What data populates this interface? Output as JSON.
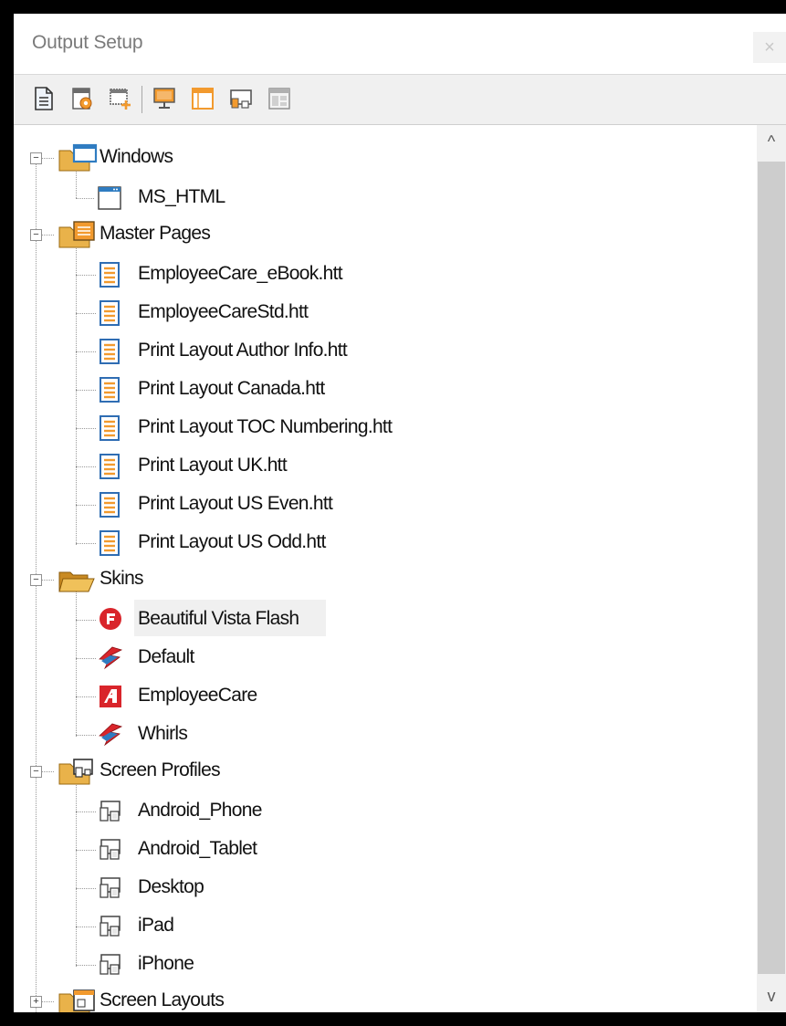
{
  "window": {
    "title": "Output Setup",
    "close_label": "×"
  },
  "toolbar": {
    "buttons": [
      {
        "icon": "new-document-icon"
      },
      {
        "icon": "properties-icon"
      },
      {
        "icon": "add-window-icon"
      },
      {
        "icon": "monitor-icon"
      },
      {
        "icon": "window-frame-icon"
      },
      {
        "icon": "screen-profile-icon"
      },
      {
        "icon": "layout-grid-icon"
      }
    ]
  },
  "tree": {
    "windows": {
      "label": "Windows",
      "children": [
        "MS_HTML"
      ]
    },
    "master_pages": {
      "label": "Master Pages",
      "children": [
        "EmployeeCare_eBook.htt",
        "EmployeeCareStd.htt",
        "Print Layout Author Info.htt",
        "Print Layout Canada.htt",
        "Print Layout TOC Numbering.htt",
        "Print Layout UK.htt",
        "Print Layout US Even.htt",
        "Print Layout US Odd.htt"
      ]
    },
    "skins": {
      "label": "Skins",
      "children": [
        "Beautiful Vista Flash",
        "Default",
        "EmployeeCare",
        "Whirls"
      ]
    },
    "screen_profiles": {
      "label": "Screen Profiles",
      "children": [
        "Android_Phone",
        "Android_Tablet",
        "Desktop",
        "iPad",
        "iPhone"
      ]
    },
    "screen_layouts": {
      "label": "Screen Layouts"
    }
  },
  "scrollbar": {
    "up_arrow": "^",
    "down_arrow": "v"
  },
  "colors": {
    "accent_orange": "#f29a2e",
    "folder_yellow": "#e9b24a",
    "skin_red": "#d9252b",
    "window_blue": "#2f7cc1"
  }
}
